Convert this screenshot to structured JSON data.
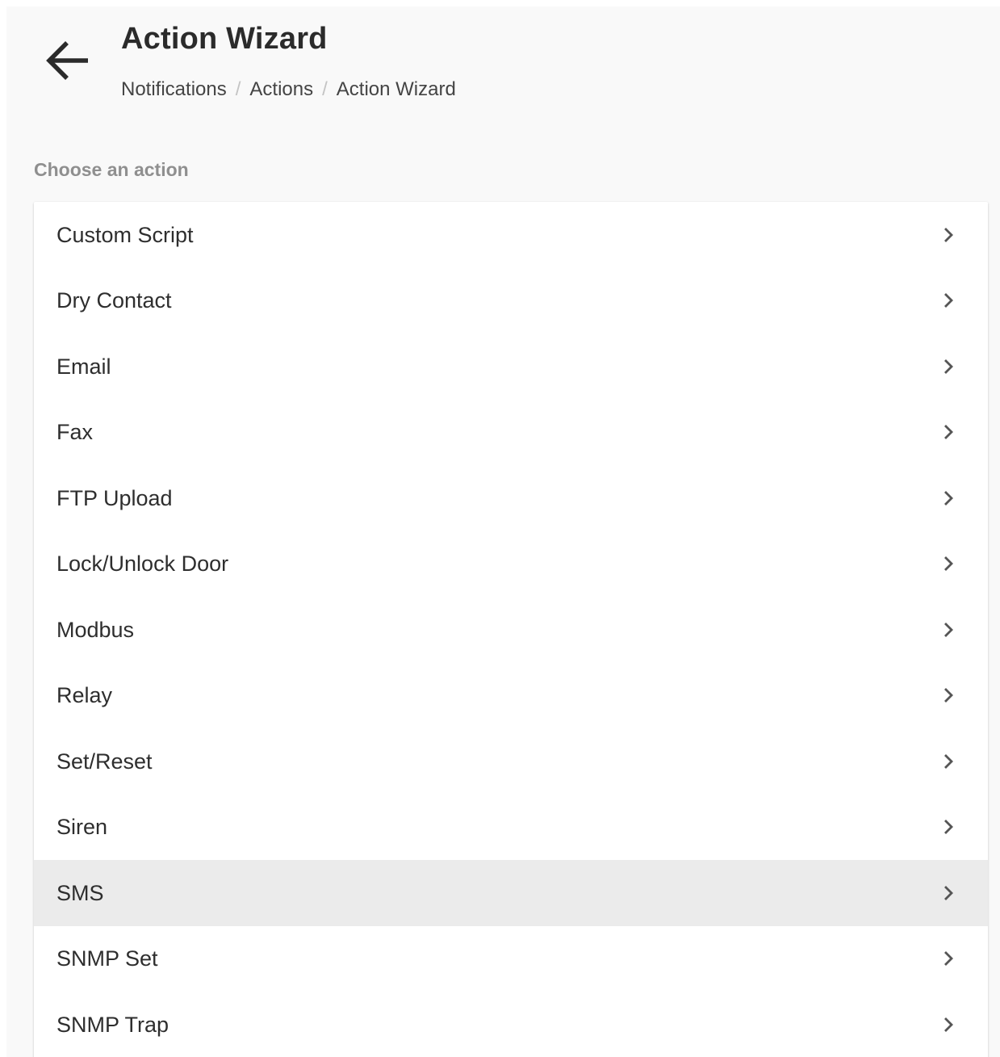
{
  "header": {
    "title": "Action Wizard",
    "back_icon": "arrow-left-icon"
  },
  "breadcrumb": [
    {
      "label": "Notifications"
    },
    {
      "label": "Actions"
    },
    {
      "label": "Action Wizard"
    }
  ],
  "breadcrumb_separator": "/",
  "section_label": "Choose an action",
  "actions": {
    "items": [
      {
        "label": "Custom Script"
      },
      {
        "label": "Dry Contact"
      },
      {
        "label": "Email"
      },
      {
        "label": "Fax"
      },
      {
        "label": "FTP Upload"
      },
      {
        "label": "Lock/Unlock Door"
      },
      {
        "label": "Modbus"
      },
      {
        "label": "Relay"
      },
      {
        "label": "Set/Reset"
      },
      {
        "label": "Siren"
      },
      {
        "label": "SMS"
      },
      {
        "label": "SNMP Set"
      },
      {
        "label": "SNMP Trap"
      }
    ],
    "highlighted_label": "SMS",
    "item_icon": "chevron-right-icon"
  },
  "colors": {
    "page_background": "#f9f9f9",
    "card_background": "#ffffff",
    "highlight_background": "#ebebeb",
    "section_label": "#8f8f8f",
    "text": "#2e2e2e"
  }
}
